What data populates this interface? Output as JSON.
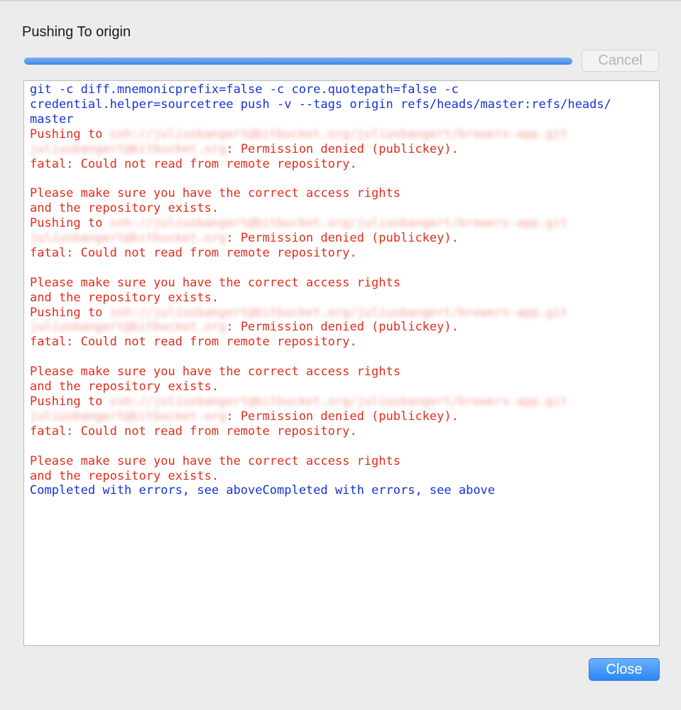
{
  "dialog": {
    "title": "Pushing To origin",
    "progress": 1.0,
    "cancel_label": "Cancel",
    "close_label": "Close"
  },
  "log": {
    "lines": [
      {
        "type": "command",
        "parts": [
          {
            "text": "git -c diff.mnemonicprefix=false -c core.quotepath=false -c"
          }
        ]
      },
      {
        "type": "command",
        "parts": [
          {
            "text": "credential.helper=sourcetree push -v --tags origin refs/heads/master:refs/heads/"
          }
        ]
      },
      {
        "type": "command",
        "parts": [
          {
            "text": "master"
          }
        ]
      },
      {
        "type": "error",
        "parts": [
          {
            "text": "Pushing to "
          },
          {
            "text": "ssh://juliusbangert@bitbucket.org/juliusbangert/brewers-app.git",
            "redacted": true
          }
        ]
      },
      {
        "type": "error",
        "parts": [
          {
            "text": "juliusbangert@bitbucket.org",
            "redacted": true
          },
          {
            "text": ": Permission denied (publickey)."
          }
        ]
      },
      {
        "type": "error",
        "parts": [
          {
            "text": "fatal: Could not read from remote repository."
          }
        ]
      },
      {
        "type": "error",
        "parts": [
          {
            "text": ""
          }
        ]
      },
      {
        "type": "error",
        "parts": [
          {
            "text": "Please make sure you have the correct access rights"
          }
        ]
      },
      {
        "type": "error",
        "parts": [
          {
            "text": "and the repository exists."
          }
        ]
      },
      {
        "type": "error",
        "parts": [
          {
            "text": "Pushing to "
          },
          {
            "text": "ssh://juliusbangert@bitbucket.org/juliusbangert/brewers-app.git",
            "redacted": true
          }
        ]
      },
      {
        "type": "error",
        "parts": [
          {
            "text": "juliusbangert@bitbucket.org",
            "redacted": true
          },
          {
            "text": ": Permission denied (publickey)."
          }
        ]
      },
      {
        "type": "error",
        "parts": [
          {
            "text": "fatal: Could not read from remote repository."
          }
        ]
      },
      {
        "type": "error",
        "parts": [
          {
            "text": ""
          }
        ]
      },
      {
        "type": "error",
        "parts": [
          {
            "text": "Please make sure you have the correct access rights"
          }
        ]
      },
      {
        "type": "error",
        "parts": [
          {
            "text": "and the repository exists."
          }
        ]
      },
      {
        "type": "error",
        "parts": [
          {
            "text": "Pushing to "
          },
          {
            "text": "ssh://juliusbangert@bitbucket.org/juliusbangert/brewers-app.git",
            "redacted": true
          }
        ]
      },
      {
        "type": "error",
        "parts": [
          {
            "text": "juliusbangert@bitbucket.org",
            "redacted": true
          },
          {
            "text": ": Permission denied (publickey)."
          }
        ]
      },
      {
        "type": "error",
        "parts": [
          {
            "text": "fatal: Could not read from remote repository."
          }
        ]
      },
      {
        "type": "error",
        "parts": [
          {
            "text": ""
          }
        ]
      },
      {
        "type": "error",
        "parts": [
          {
            "text": "Please make sure you have the correct access rights"
          }
        ]
      },
      {
        "type": "error",
        "parts": [
          {
            "text": "and the repository exists."
          }
        ]
      },
      {
        "type": "error",
        "parts": [
          {
            "text": "Pushing to "
          },
          {
            "text": "ssh://juliusbangert@bitbucket.org/juliusbangert/brewers-app.git",
            "redacted": true
          }
        ]
      },
      {
        "type": "error",
        "parts": [
          {
            "text": "juliusbangert@bitbucket.org",
            "redacted": true
          },
          {
            "text": ": Permission denied (publickey)."
          }
        ]
      },
      {
        "type": "error",
        "parts": [
          {
            "text": "fatal: Could not read from remote repository."
          }
        ]
      },
      {
        "type": "error",
        "parts": [
          {
            "text": ""
          }
        ]
      },
      {
        "type": "error",
        "parts": [
          {
            "text": "Please make sure you have the correct access rights"
          }
        ]
      },
      {
        "type": "error",
        "parts": [
          {
            "text": "and the repository exists."
          }
        ]
      },
      {
        "type": "status",
        "parts": [
          {
            "text": "Completed with errors, see aboveCompleted with errors, see above"
          }
        ]
      }
    ]
  },
  "colors": {
    "command": "#1531d6",
    "error": "#e12d1b",
    "status": "#1531d6",
    "accent": "#2a86f7"
  }
}
